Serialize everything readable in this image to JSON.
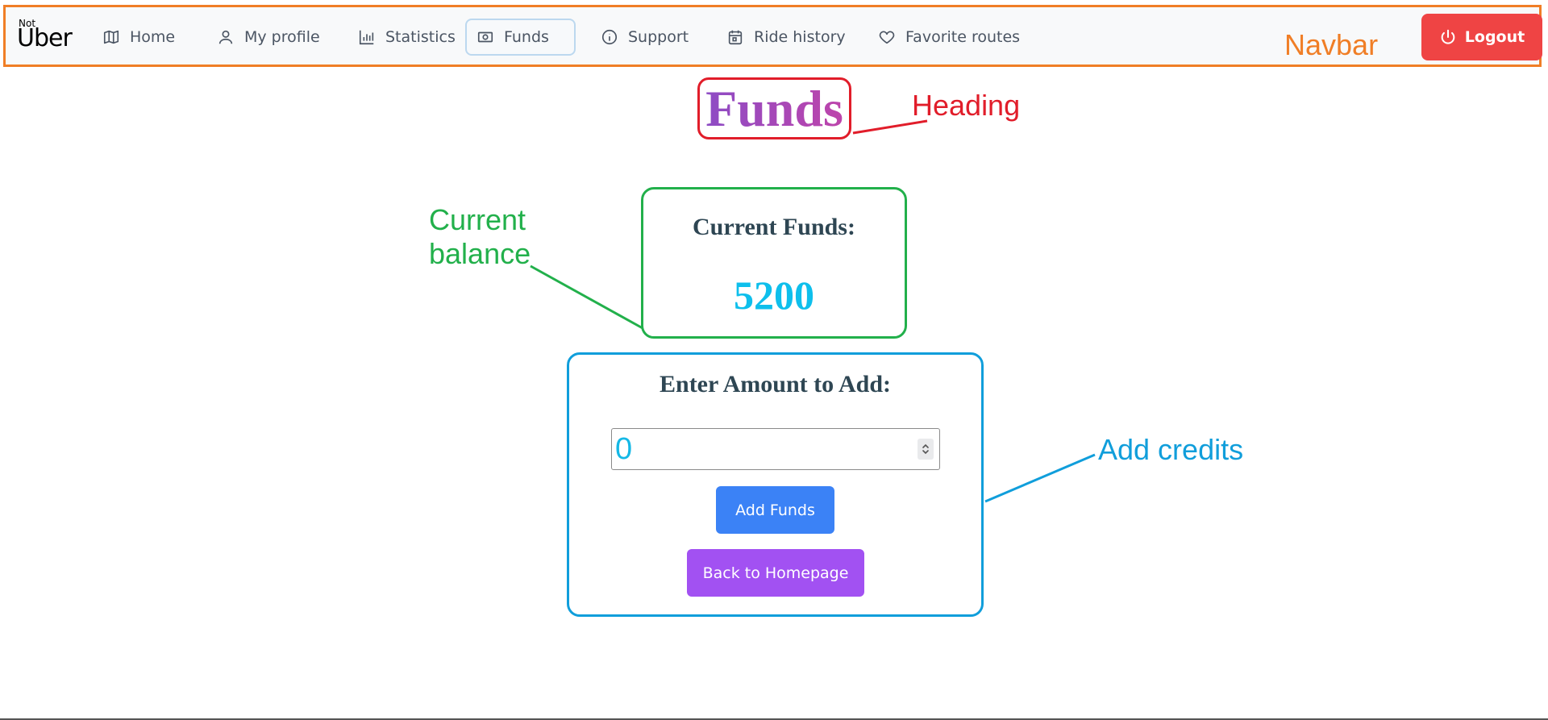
{
  "navbar": {
    "brand_small": "Not",
    "brand_big": "Uber",
    "items": [
      {
        "label": "Home",
        "icon": "map-icon"
      },
      {
        "label": "My profile",
        "icon": "user-icon"
      },
      {
        "label": "Statistics",
        "icon": "bar-chart-icon"
      },
      {
        "label": "Funds",
        "icon": "banknote-icon",
        "active": true
      },
      {
        "label": "Support",
        "icon": "info-icon"
      },
      {
        "label": "Ride history",
        "icon": "calendar-icon"
      },
      {
        "label": "Favorite routes",
        "icon": "heart-icon"
      }
    ],
    "logout_label": "Logout"
  },
  "page": {
    "heading": "Funds",
    "current_funds_label": "Current Funds:",
    "current_funds_value": "5200",
    "add_label": "Enter Amount to Add:",
    "amount_value": "0",
    "add_button": "Add Funds",
    "back_button": "Back to Homepage"
  },
  "annotations": {
    "navbar": "Navbar",
    "heading": "Heading",
    "balance_line1": "Current",
    "balance_line2": "balance",
    "credits": "Add credits"
  },
  "colors": {
    "navbar_annotation": "#f07e26",
    "heading_annotation": "#e11d2a",
    "balance_annotation": "#22b04b",
    "credits_annotation": "#109edb",
    "logout": "#ef4444",
    "add_button": "#3b82f6",
    "back_button": "#a251f2",
    "funds_value": "#0ebfec"
  }
}
